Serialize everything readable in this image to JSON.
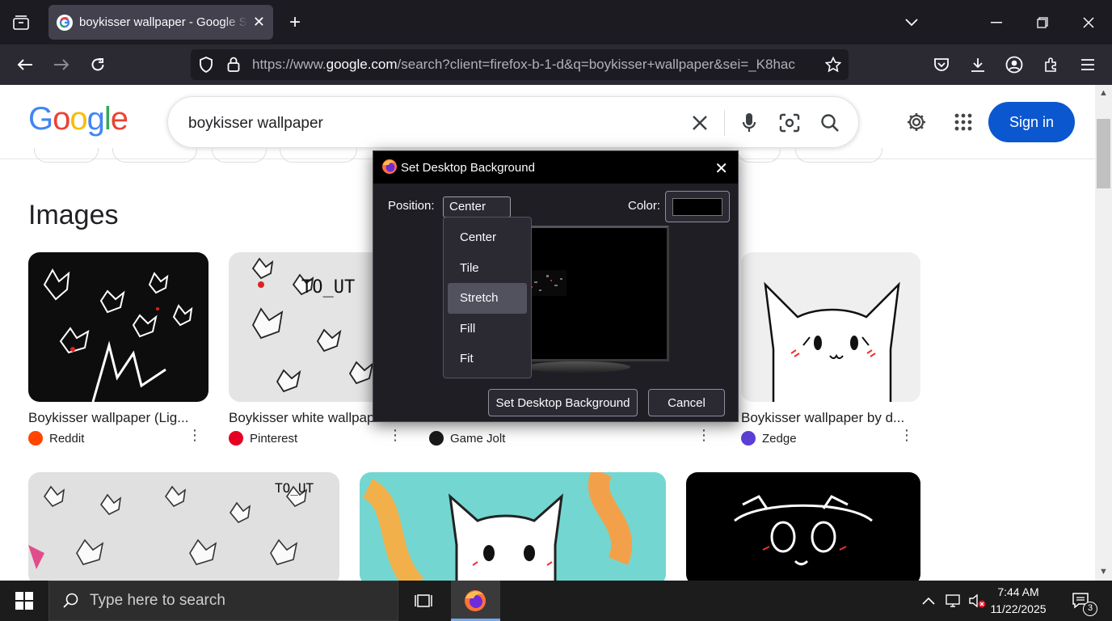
{
  "browser": {
    "tab_title": "boykisser wallpaper - Google Search",
    "url_prefix": "https://www.",
    "url_domain": "google.com",
    "url_rest": "/search?client=firefox-b-1-d&q=boykisser+wallpaper&sei=_K8hac"
  },
  "google": {
    "logo": "Google",
    "query": "boykisser wallpaper",
    "sign_in": "Sign in",
    "section_title": "Images",
    "cards": [
      {
        "title": "Boykisser wallpaper (Lig...",
        "source": "Reddit",
        "source_color": "#ff4500"
      },
      {
        "title": "Boykisser white wallpaper...",
        "source": "Pinterest",
        "source_color": "#e60023"
      },
      {
        "title": "",
        "source": "Game Jolt",
        "source_color": "#1a1a1a"
      },
      {
        "title": "Boykisser wallpaper by d...",
        "source": "Zedge",
        "source_color": "#5b3fd4"
      }
    ]
  },
  "dialog": {
    "title": "Set Desktop Background",
    "position_label": "Position:",
    "position_value": "Center",
    "color_label": "Color:",
    "color_value": "#000000",
    "options": [
      "Center",
      "Tile",
      "Stretch",
      "Fill",
      "Fit"
    ],
    "highlighted_option": "Stretch",
    "set_button": "Set Desktop Background",
    "cancel_button": "Cancel"
  },
  "taskbar": {
    "search_placeholder": "Type here to search",
    "time": "7:44 AM",
    "date": "11/22/2025",
    "notification_count": "3"
  }
}
